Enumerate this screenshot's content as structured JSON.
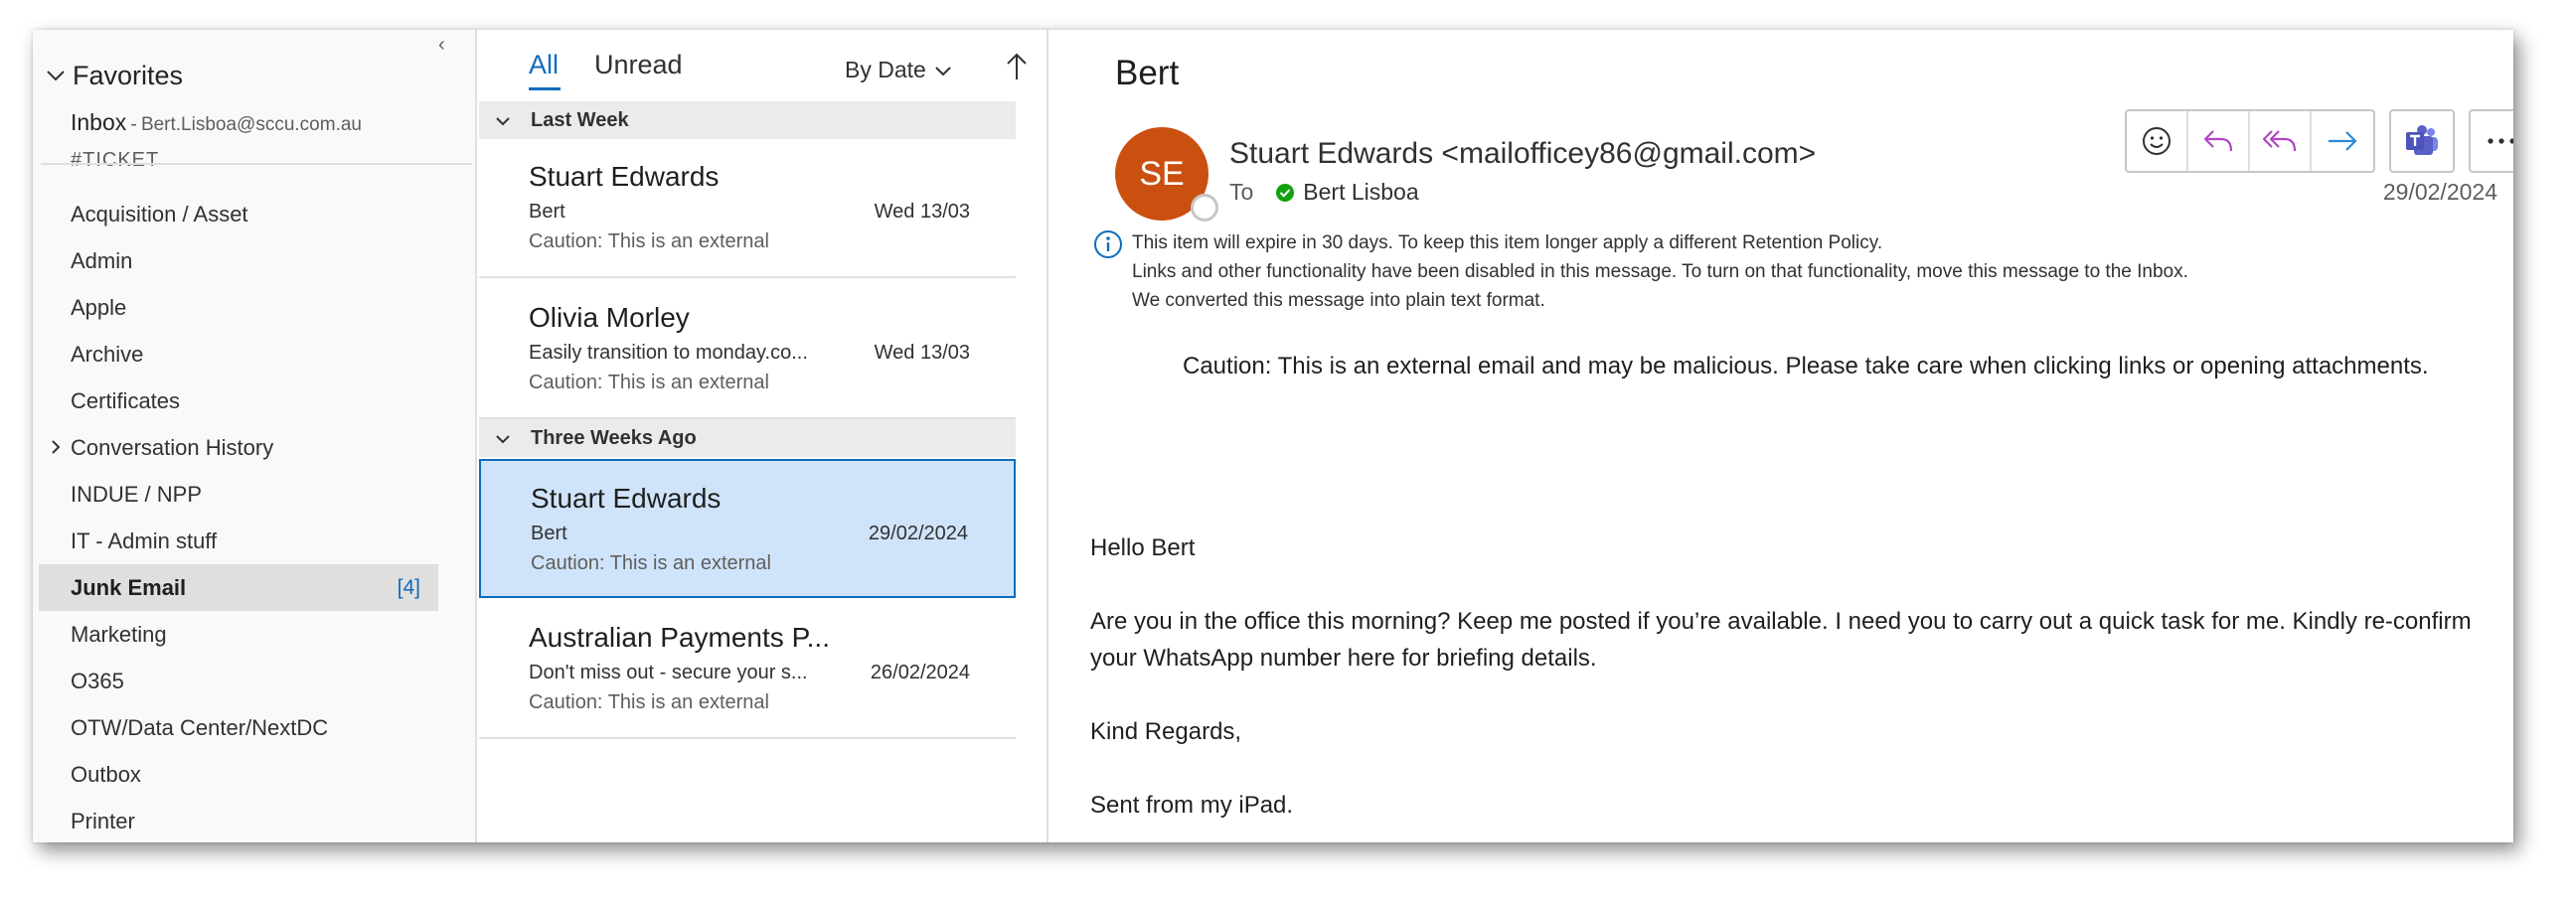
{
  "favorites": {
    "label": "Favorites",
    "inbox": {
      "label": "Inbox",
      "separator": "-",
      "account": "Bert.Lisboa@sccu.com.au"
    },
    "partial_folder_label": "#TICKET"
  },
  "folders": [
    {
      "label": "Acquisition / Asset"
    },
    {
      "label": "Admin"
    },
    {
      "label": "Apple"
    },
    {
      "label": "Archive"
    },
    {
      "label": "Certificates"
    },
    {
      "label": "Conversation History",
      "expandable": true
    },
    {
      "label": "INDUE / NPP"
    },
    {
      "label": "IT - Admin stuff"
    },
    {
      "label": "Junk Email",
      "selected": true,
      "count": "[4]"
    },
    {
      "label": "Marketing"
    },
    {
      "label": "O365"
    },
    {
      "label": "OTW/Data Center/NextDC"
    },
    {
      "label": "Outbox"
    },
    {
      "label": "Printer"
    }
  ],
  "message_list": {
    "tabs": {
      "all": "All",
      "unread": "Unread"
    },
    "sort_label": "By Date",
    "groups": [
      {
        "label": "Last Week"
      },
      {
        "label": "Three Weeks Ago"
      }
    ],
    "messages": [
      {
        "sender": "Stuart Edwards",
        "subject": "Bert",
        "date": "Wed 13/03",
        "preview": "Caution: This is an external"
      },
      {
        "sender": "Olivia Morley",
        "subject": "Easily transition to monday.co...",
        "date": "Wed 13/03",
        "preview": "Caution: This is an external"
      },
      {
        "sender": "Stuart Edwards",
        "subject": "Bert",
        "date": "29/02/2024",
        "preview": "Caution: This is an external",
        "selected": true
      },
      {
        "sender": "Australian Payments P...",
        "subject": "Don't miss out - secure your s...",
        "date": "26/02/2024",
        "preview": "Caution: This is an external"
      }
    ]
  },
  "reading": {
    "subject": "Bert",
    "avatar_initials": "SE",
    "avatar_color": "#ca5010",
    "from": "Stuart Edwards <mailofficey86@gmail.com>",
    "to_label": "To",
    "to_name": "Bert Lisboa",
    "date": "29/02/2024",
    "actions": [
      "emoji-icon",
      "reply-icon",
      "reply-all-icon",
      "forward-icon",
      "teams-icon",
      "more-options-icon"
    ],
    "info_lines": [
      "This item will expire in 30 days. To keep this item longer apply a different Retention Policy.",
      "Links and other functionality have been disabled in this message. To turn on that functionality, move this message to the Inbox.",
      "We converted this message into plain text format."
    ],
    "body": {
      "caution": "Caution: This is an external email and may be malicious. Please take care when clicking links or opening attachments.",
      "greeting": "Hello Bert",
      "main": "Are you in the office this morning? Keep me posted if you’re available. I need you to carry out a quick task for me. Kindly re-confirm your WhatsApp number here for briefing details.",
      "closing": "Kind Regards,",
      "signature": "Sent from my iPad."
    }
  },
  "colors": {
    "accent": "#0f6cbd",
    "selected_row": "#cfe4fa",
    "reply_icons": "#b146c2",
    "forward_icon": "#2b88d8",
    "teams": "#5b5fc7"
  }
}
